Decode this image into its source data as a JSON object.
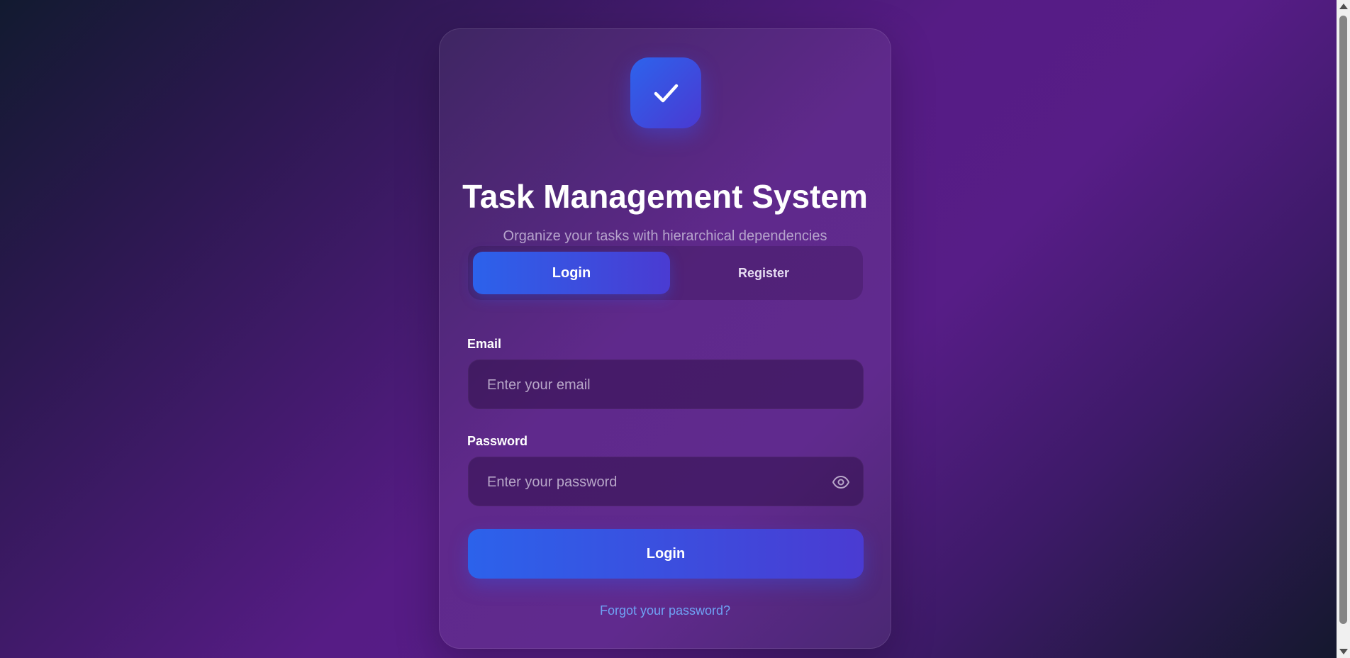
{
  "app": {
    "title": "Task Management System",
    "subtitle": "Organize your tasks with hierarchical dependencies",
    "logo_icon": "check-icon"
  },
  "tabs": [
    {
      "label": "Login",
      "active": true
    },
    {
      "label": "Register",
      "active": false
    }
  ],
  "form": {
    "email": {
      "label": "Email",
      "placeholder": "Enter your email",
      "value": ""
    },
    "password": {
      "label": "Password",
      "placeholder": "Enter your password",
      "value": "",
      "toggle_icon": "eye-icon"
    },
    "submit_label": "Login",
    "forgot_link": "Forgot your password?"
  },
  "colors": {
    "accent_start": "#2c62eb",
    "accent_end": "#4a3bd2",
    "link": "#6fa3f5",
    "background_purple": "#561c85"
  }
}
